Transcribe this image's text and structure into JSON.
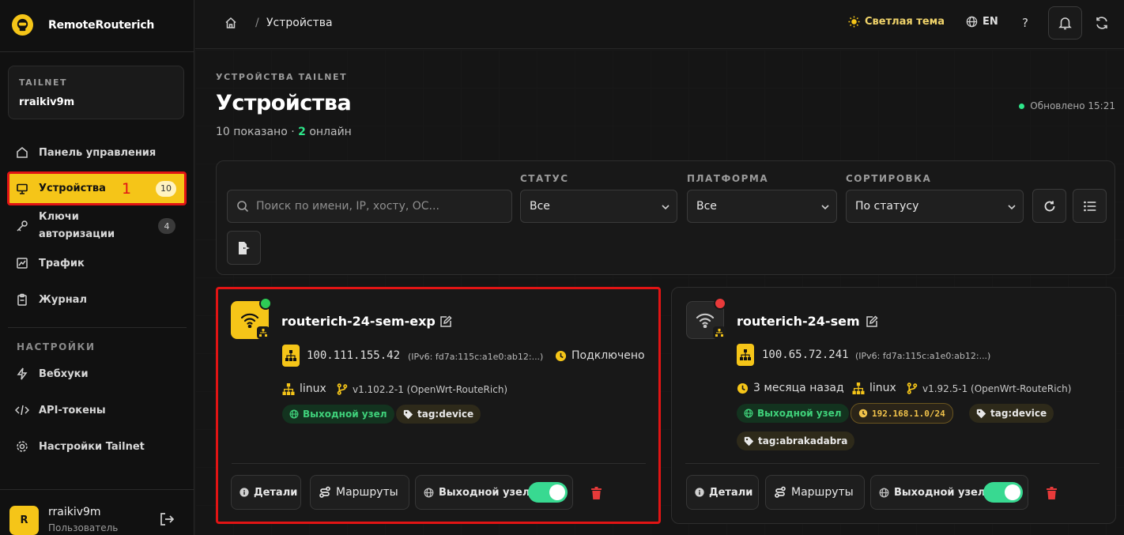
{
  "brand": {
    "name": "RemoteRouterich"
  },
  "tailnet": {
    "label": "TAILNET",
    "name": "rraikiv9m"
  },
  "nav": {
    "dashboard": "Панель управления",
    "devices": "Устройства",
    "devices_badge": "10",
    "annotation": "1",
    "auth_keys": "Ключи\nавторизации",
    "auth_keys_line1": "Ключи",
    "auth_keys_line2": "авторизации",
    "auth_keys_badge": "4",
    "traffic": "Трафик",
    "journal": "Журнал",
    "settings_section": "НАСТРОЙКИ",
    "webhooks": "Вебхуки",
    "api_tokens": "API-токены",
    "tailnet_settings": "Настройки Tailnet"
  },
  "user": {
    "initial": "R",
    "name": "rraikiv9m",
    "role": "Пользователь"
  },
  "topbar": {
    "breadcrumb_sep": "/",
    "breadcrumb_current": "Устройства",
    "theme": "Светлая тема",
    "lang": "EN",
    "help": "?"
  },
  "page": {
    "eyebrow": "УСТРОЙСТВА TAILNET",
    "title": "Устройства",
    "shown": "10 показано · ",
    "online_count": "2",
    "online_suffix": " онлайн",
    "updated": "Обновлено 15:21"
  },
  "filters": {
    "search_placeholder": "Поиск по имени, IP, хосту, ОС...",
    "status_label": "СТАТУС",
    "status_value": "Все",
    "platform_label": "ПЛАТФОРМА",
    "platform_value": "Все",
    "sort_label": "СОРТИРОВКА",
    "sort_value": "По статусу"
  },
  "devices": [
    {
      "name": "routerich-24-sem-exp",
      "status_color": "#2ecc55",
      "ip": "100.111.155.42",
      "ipv6": "(IPv6: fd7a:115c:a1e0:ab12:...)",
      "connection": "Подключено",
      "os": "linux",
      "version": "v1.102.2-1 (OpenWrt-RouteRich)",
      "chips": [
        "Выходной узел",
        "tag:device"
      ],
      "actions": {
        "details": "Детали",
        "routes": "Маршруты",
        "exit_node": "Выходной узел"
      }
    },
    {
      "name": "routerich-24-sem",
      "status_color": "#e83a3a",
      "ip": "100.65.72.241",
      "ipv6": "(IPv6: fd7a:115c:a1e0:ab12:...)",
      "last_seen": "3 месяца назад",
      "os": "linux",
      "version": "v1.92.5-1 (OpenWrt-RouteRich)",
      "chips": [
        "Выходной узел",
        "192.168.1.0/24",
        "tag:device",
        "tag:abrakadabra"
      ],
      "actions": {
        "details": "Детали",
        "routes": "Маршруты",
        "exit_node": "Выходной узел"
      }
    }
  ]
}
